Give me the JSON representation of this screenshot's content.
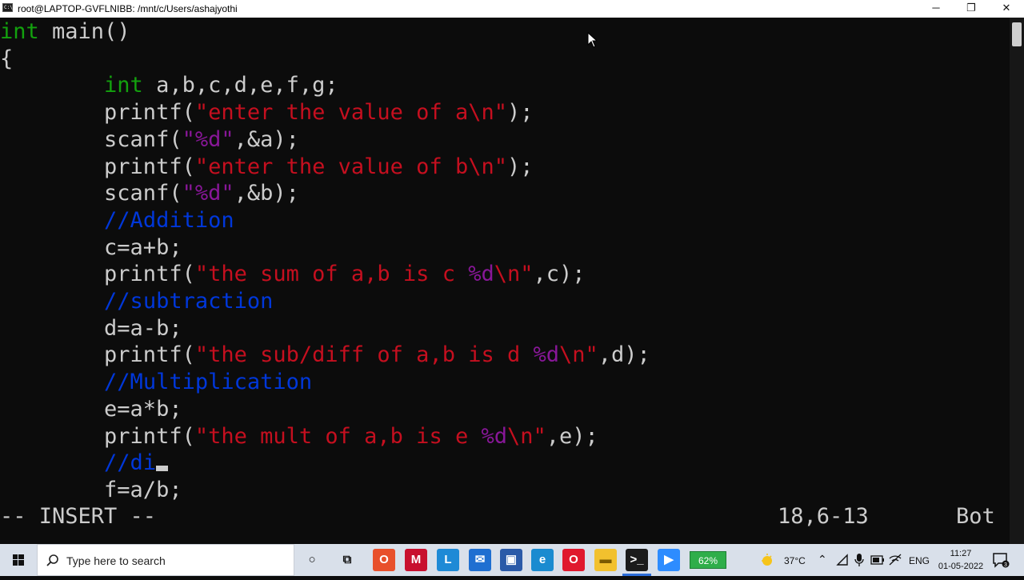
{
  "window": {
    "title": "root@LAPTOP-GVFLNIBB: /mnt/c/Users/ashajyothi",
    "icon_label": "C:\\",
    "minimize_glyph": "─",
    "maximize_glyph": "❐",
    "close_glyph": "✕"
  },
  "colors": {
    "background": "#0c0c0c",
    "foreground": "#cccccc",
    "type_keyword": "#13a10e",
    "string": "#c50f1f",
    "format_specifier": "#881798",
    "comment": "#0037da"
  },
  "editor": {
    "lines": [
      [
        {
          "t": "int",
          "c": "type"
        },
        {
          "t": " main()",
          "c": "plain"
        }
      ],
      [
        {
          "t": "{",
          "c": "plain"
        }
      ],
      [
        {
          "t": "        ",
          "c": "plain"
        },
        {
          "t": "int",
          "c": "type"
        },
        {
          "t": " a,b,c,d,e,f,g;",
          "c": "plain"
        }
      ],
      [
        {
          "t": "        printf(",
          "c": "plain"
        },
        {
          "t": "\"enter the value of a\\n\"",
          "c": "str"
        },
        {
          "t": ");",
          "c": "plain"
        }
      ],
      [
        {
          "t": "        scanf(",
          "c": "plain"
        },
        {
          "t": "\"%d\"",
          "c": "fmt"
        },
        {
          "t": ",&a);",
          "c": "plain"
        }
      ],
      [
        {
          "t": "        printf(",
          "c": "plain"
        },
        {
          "t": "\"enter the value of b\\n\"",
          "c": "str"
        },
        {
          "t": ");",
          "c": "plain"
        }
      ],
      [
        {
          "t": "        scanf(",
          "c": "plain"
        },
        {
          "t": "\"%d\"",
          "c": "fmt"
        },
        {
          "t": ",&b);",
          "c": "plain"
        }
      ],
      [
        {
          "t": "        ",
          "c": "plain"
        },
        {
          "t": "//Addition",
          "c": "cmt"
        }
      ],
      [
        {
          "t": "        c=a+b;",
          "c": "plain"
        }
      ],
      [
        {
          "t": "        printf(",
          "c": "plain"
        },
        {
          "t": "\"the sum of a,b is c ",
          "c": "str"
        },
        {
          "t": "%d",
          "c": "fmt"
        },
        {
          "t": "\\n\"",
          "c": "str"
        },
        {
          "t": ",c);",
          "c": "plain"
        }
      ],
      [
        {
          "t": "        ",
          "c": "plain"
        },
        {
          "t": "//subtraction",
          "c": "cmt"
        }
      ],
      [
        {
          "t": "        d=a-b;",
          "c": "plain"
        }
      ],
      [
        {
          "t": "        printf(",
          "c": "plain"
        },
        {
          "t": "\"the sub/diff of a,b is d ",
          "c": "str"
        },
        {
          "t": "%d",
          "c": "fmt"
        },
        {
          "t": "\\n\"",
          "c": "str"
        },
        {
          "t": ",d);",
          "c": "plain"
        }
      ],
      [
        {
          "t": "        ",
          "c": "plain"
        },
        {
          "t": "//Multiplication",
          "c": "cmt"
        }
      ],
      [
        {
          "t": "        e=a*b;",
          "c": "plain"
        }
      ],
      [
        {
          "t": "        printf(",
          "c": "plain"
        },
        {
          "t": "\"the mult of a,b is e ",
          "c": "str"
        },
        {
          "t": "%d",
          "c": "fmt"
        },
        {
          "t": "\\n\"",
          "c": "str"
        },
        {
          "t": ",e);",
          "c": "plain"
        }
      ],
      [
        {
          "t": "        ",
          "c": "plain"
        },
        {
          "t": "//di",
          "c": "cmt"
        }
      ],
      [
        {
          "t": "        f=a/b;",
          "c": "plain"
        }
      ]
    ],
    "cursor_line_index": 16,
    "status_mode": "-- INSERT --",
    "status_position": "18,6-13",
    "status_scroll": "Bot"
  },
  "taskbar": {
    "search_placeholder": "Type here to search",
    "apps": [
      {
        "name": "cortana-icon",
        "glyph": "○",
        "bg": "transparent",
        "fg": "#111"
      },
      {
        "name": "task-view-icon",
        "glyph": "⧉",
        "bg": "transparent",
        "fg": "#111"
      },
      {
        "name": "office-icon",
        "glyph": "O",
        "bg": "#e8502b",
        "fg": "#fff"
      },
      {
        "name": "mcafee-icon",
        "glyph": "M",
        "bg": "#c8102e",
        "fg": "#fff"
      },
      {
        "name": "l-app-icon",
        "glyph": "L",
        "bg": "#1e8ad6",
        "fg": "#fff"
      },
      {
        "name": "mail-icon",
        "glyph": "✉",
        "bg": "#1f6fd1",
        "fg": "#fff"
      },
      {
        "name": "store-icon",
        "glyph": "▣",
        "bg": "#2a5aa8",
        "fg": "#fff"
      },
      {
        "name": "edge-icon",
        "glyph": "e",
        "bg": "#1a8bd0",
        "fg": "#fff"
      },
      {
        "name": "opera-icon",
        "glyph": "O",
        "bg": "#e0182d",
        "fg": "#fff"
      },
      {
        "name": "file-explorer-icon",
        "glyph": "▬",
        "bg": "#f2c12e",
        "fg": "#7a5a00"
      },
      {
        "name": "terminal-icon",
        "glyph": ">_",
        "bg": "#1b1b1b",
        "fg": "#fff"
      },
      {
        "name": "zoom-icon",
        "glyph": "▶",
        "bg": "#2d8cff",
        "fg": "#fff"
      }
    ],
    "battery_text": "62%",
    "weather_temp": "37°C",
    "language": "ENG",
    "time": "11:27",
    "date": "01-05-2022",
    "notification_count": "3"
  }
}
